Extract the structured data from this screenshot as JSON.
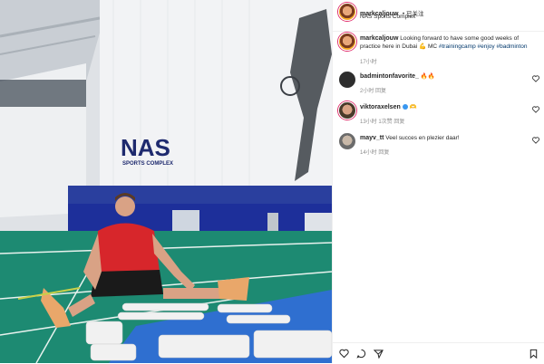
{
  "post": {
    "author": "markcaljouw",
    "follow_status": "已关注",
    "location": "NAS Sports Complex",
    "caption_user": "markcaljouw",
    "caption_text": "Looking forward to have some good weeks of practice here in Dubai",
    "caption_emoji": "💪",
    "caption_mention_prefix": "MC",
    "hashtags": [
      "#trainingcamp",
      "#enjoy",
      "#badminton"
    ],
    "time": "17小时",
    "wall_logo": {
      "big": "NAS",
      "small": "SPORTS COMPLEX"
    }
  },
  "comments": [
    {
      "user": "badmintonfavorite_",
      "text": "🔥🔥",
      "meta": "2小时  回复"
    },
    {
      "user": "viktoraxelsen",
      "verified": true,
      "text": "🫶",
      "meta": "13小时  1次赞  回复"
    },
    {
      "user": "mayv_tt",
      "text": "Veel succes en plezier daar!",
      "meta": "14小时  回复"
    }
  ],
  "actions": [
    "heart-icon",
    "comment-icon",
    "share-icon",
    "bookmark-icon"
  ],
  "colors": {
    "court": "#1d8a72",
    "wall_blue": "#1d2f9a",
    "mat": "#2f6fd0",
    "accent": "#e1306c"
  }
}
